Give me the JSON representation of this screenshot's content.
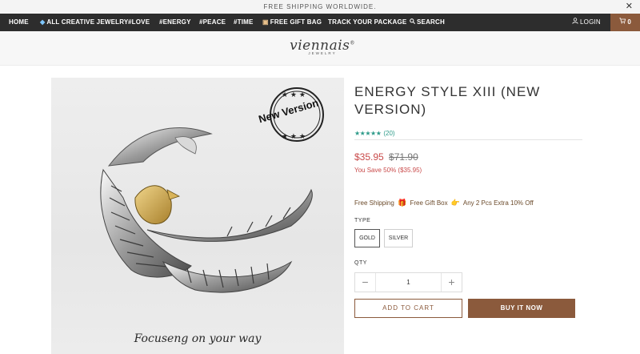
{
  "announcement": {
    "text": "FREE SHIPPING WORLDWIDE.",
    "close_icon": "close-icon"
  },
  "nav": {
    "items": [
      {
        "label": "HOME",
        "icon": ""
      },
      {
        "label": "ALL CREATIVE JEWELRY",
        "icon": "diamond-icon"
      },
      {
        "label": "#LOVE",
        "icon": ""
      },
      {
        "label": "#ENERGY",
        "icon": ""
      },
      {
        "label": "#PEACE",
        "icon": ""
      },
      {
        "label": "#TIME",
        "icon": ""
      },
      {
        "label": "FREE GIFT BAG",
        "icon": "gift-bag-icon"
      },
      {
        "label": "TRACK YOUR PACKAGE",
        "icon": ""
      },
      {
        "label": "SEARCH",
        "icon": "search-icon"
      }
    ],
    "login": "LOGIN",
    "cart_count": "0"
  },
  "logo": {
    "text": "viennais",
    "registered": "®",
    "subtitle": "JEWELRY"
  },
  "product": {
    "badge_text": "New Version",
    "caption": "Focuseng on your way",
    "title": "ENERGY STYLE XIII (NEW VERSION)",
    "stars": "★★★★★",
    "rating": 5,
    "review_count": "(20)",
    "price": "$35.95",
    "compare_price": "$71.90",
    "savings": "You Save 50% ($35.95)",
    "promo": {
      "part1": "Free Shipping",
      "part2": "Free Gift Box",
      "part3": "Any 2 Pcs Extra 10% Off"
    },
    "type_label": "TYPE",
    "options": [
      "GOLD",
      "SILVER"
    ],
    "selected_option": "GOLD",
    "qty_label": "QTY",
    "quantity": "1",
    "add_to_cart": "ADD TO CART",
    "buy_now": "BUY IT NOW"
  },
  "colors": {
    "accent": "#8b5a3c",
    "price": "#c94a4a",
    "nav_bg": "#2d2d2d",
    "stars": "#2e9b8a"
  }
}
